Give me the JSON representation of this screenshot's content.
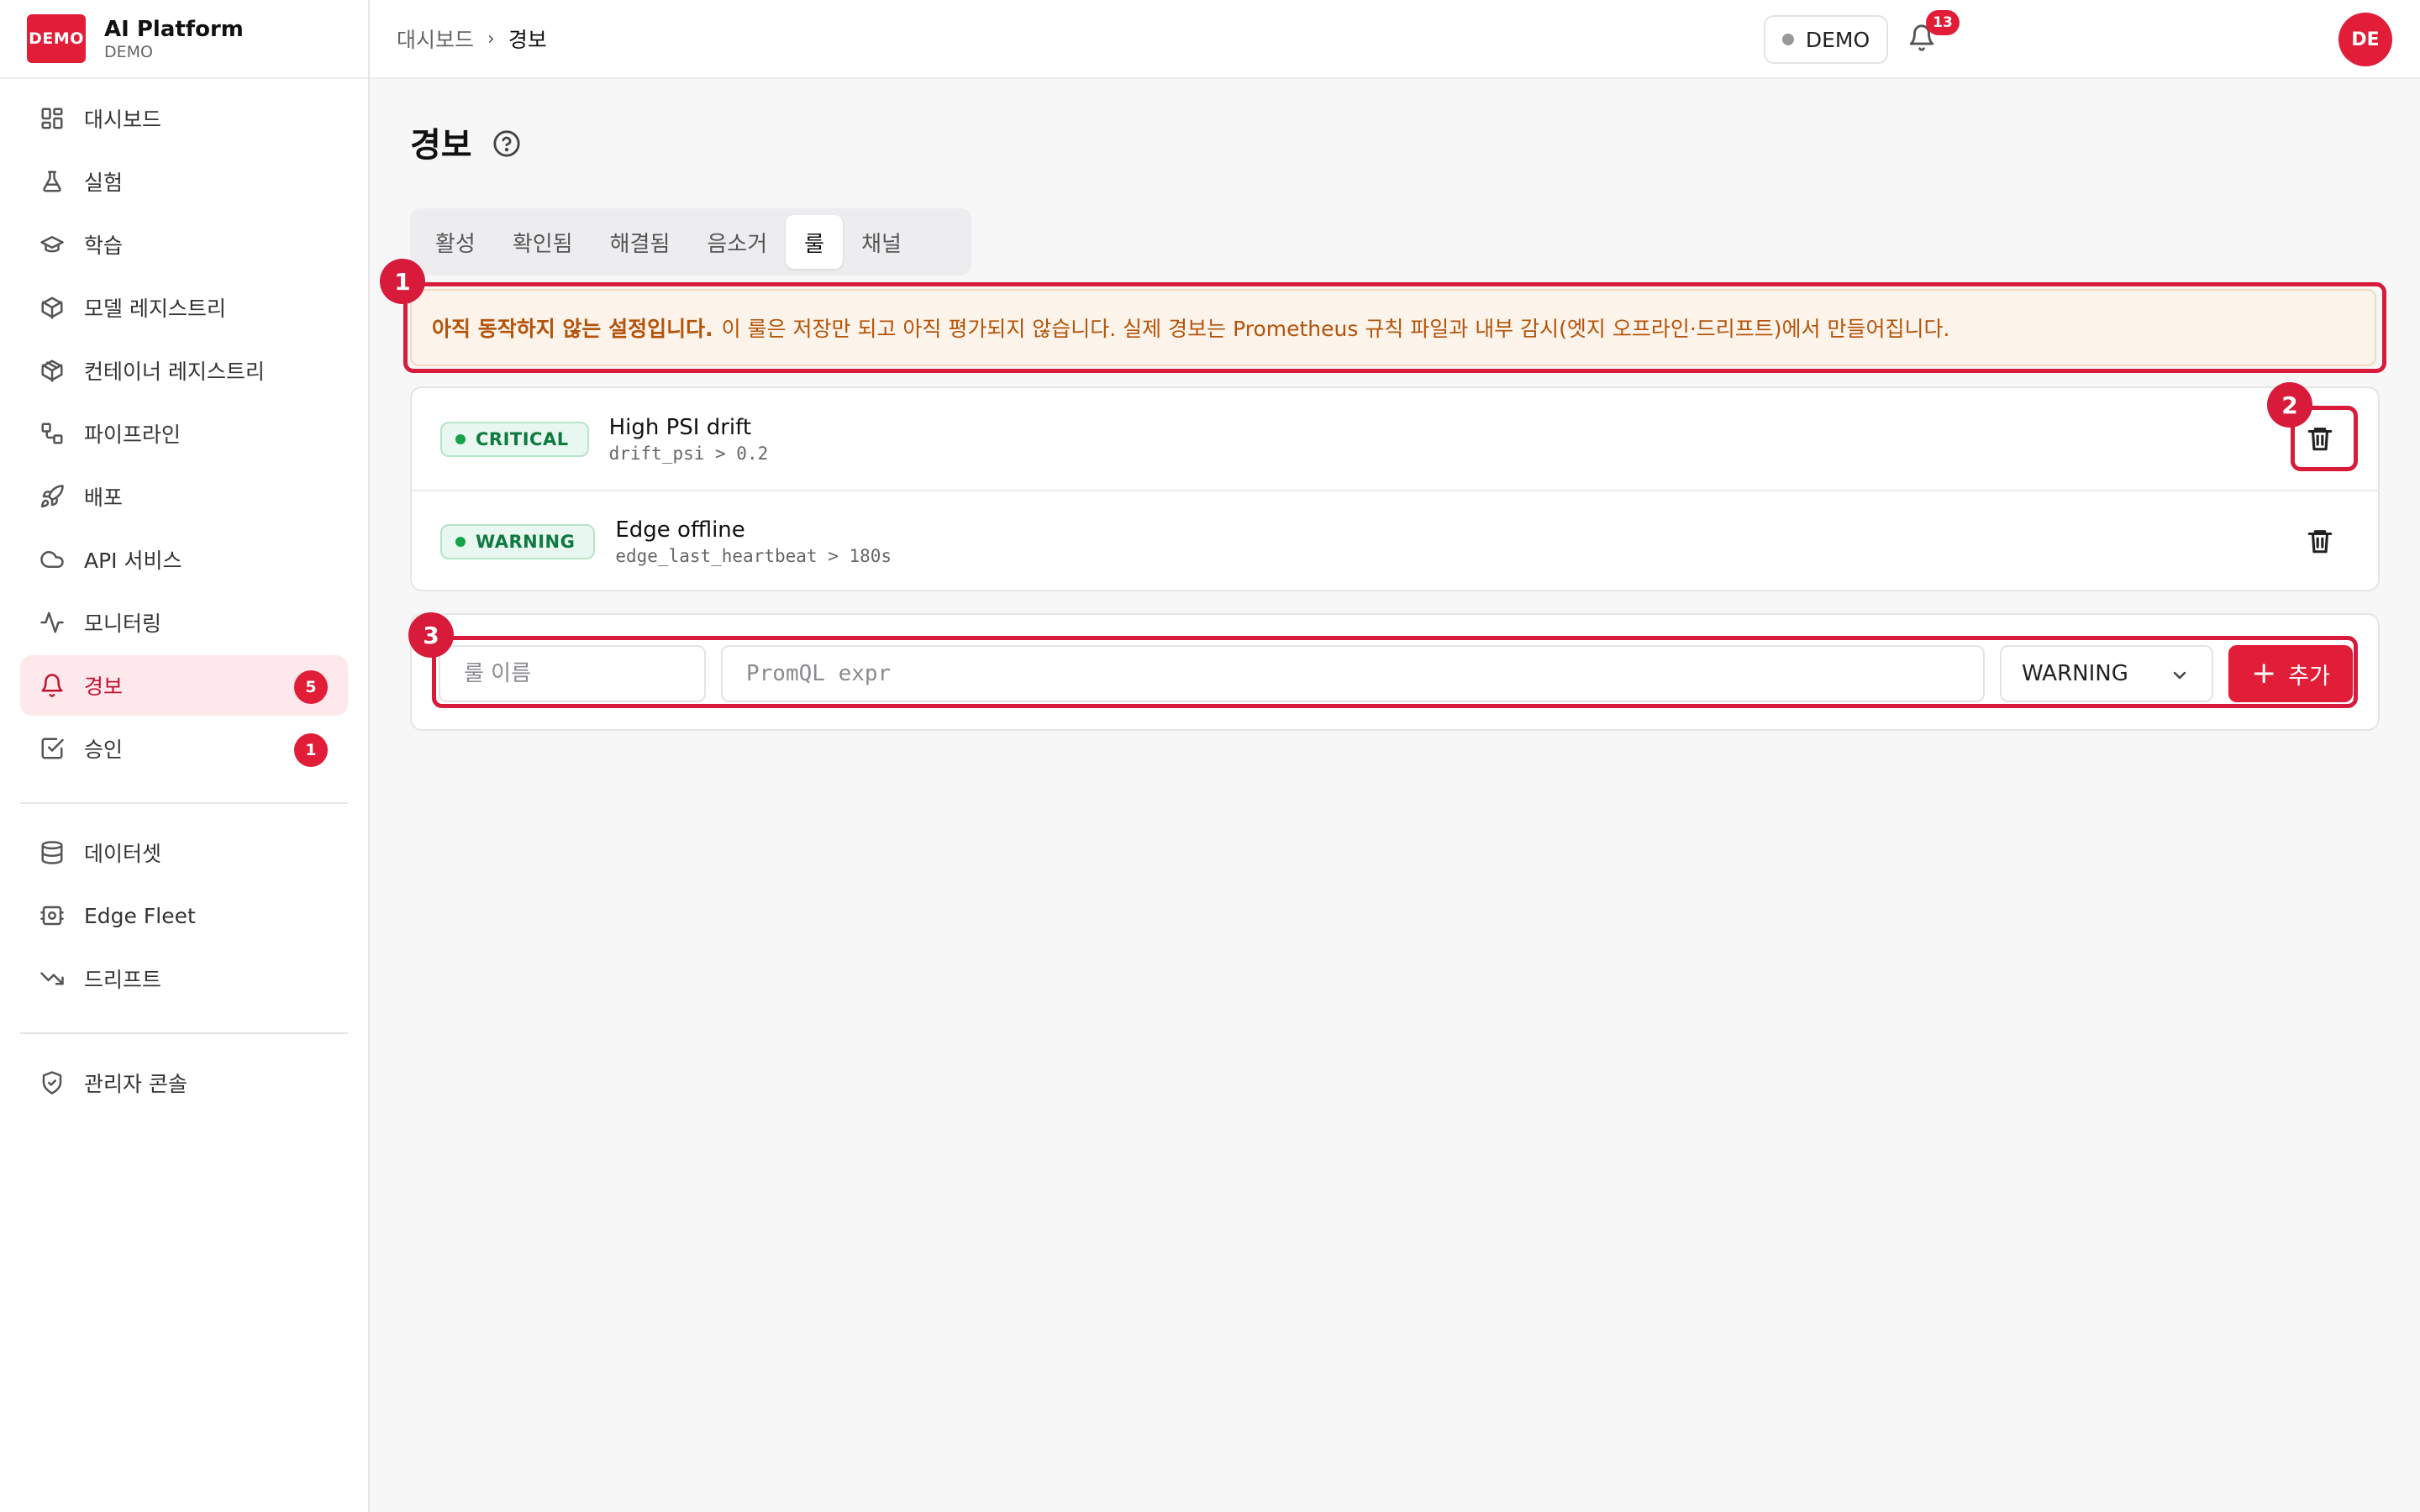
{
  "brand": {
    "logo_text": "DEMO",
    "title": "AI Platform",
    "subtitle": "DEMO"
  },
  "sidebar": {
    "group1": [
      {
        "label": "대시보드",
        "icon": "dashboard-icon"
      },
      {
        "label": "실험",
        "icon": "flask-icon"
      },
      {
        "label": "학습",
        "icon": "graduation-cap-icon"
      },
      {
        "label": "모델 레지스트리",
        "icon": "cube-icon"
      },
      {
        "label": "컨테이너 레지스트리",
        "icon": "package-icon"
      },
      {
        "label": "파이프라인",
        "icon": "workflow-icon"
      },
      {
        "label": "배포",
        "icon": "rocket-icon"
      },
      {
        "label": "API 서비스",
        "icon": "cloud-icon"
      },
      {
        "label": "모니터링",
        "icon": "activity-icon"
      },
      {
        "label": "경보",
        "icon": "bell-icon",
        "badge": "5",
        "active": true
      },
      {
        "label": "승인",
        "icon": "check-square-icon",
        "badge": "1"
      }
    ],
    "group2": [
      {
        "label": "데이터셋",
        "icon": "database-icon"
      },
      {
        "label": "Edge Fleet",
        "icon": "edge-device-icon"
      },
      {
        "label": "드리프트",
        "icon": "trending-down-icon"
      }
    ],
    "group3": [
      {
        "label": "관리자 콘솔",
        "icon": "shield-check-icon"
      }
    ]
  },
  "topbar": {
    "breadcrumb": [
      "대시보드",
      "경보"
    ],
    "env_label": "DEMO",
    "notification_count": "13",
    "avatar_initials": "DE"
  },
  "page": {
    "title": "경보",
    "tabs": [
      {
        "label": "활성"
      },
      {
        "label": "확인됨"
      },
      {
        "label": "해결됨"
      },
      {
        "label": "음소거"
      },
      {
        "label": "룰",
        "active": true
      },
      {
        "label": "채널"
      }
    ],
    "banner": {
      "strong": "아직 동작하지 않는 설정입니다.",
      "text": "이 룰은 저장만 되고 아직 평가되지 않습니다. 실제 경보는 Prometheus 규칙 파일과 내부 감시(엣지 오프라인·드리프트)에서 만들어집니다."
    },
    "rules": [
      {
        "severity": "CRITICAL",
        "name": "High PSI drift",
        "expr": "drift_psi > 0.2"
      },
      {
        "severity": "WARNING",
        "name": "Edge offline",
        "expr": "edge_last_heartbeat > 180s"
      }
    ],
    "form": {
      "name_placeholder": "룰 이름",
      "expr_placeholder": "PromQL expr",
      "severity_selected": "WARNING",
      "add_label": "추가"
    }
  },
  "annotations": [
    "1",
    "2",
    "3"
  ],
  "colors": {
    "accent": "#e11d38",
    "annotation": "#d81b3a",
    "banner_text": "#b45309",
    "severity_green": "#0f7a40"
  }
}
